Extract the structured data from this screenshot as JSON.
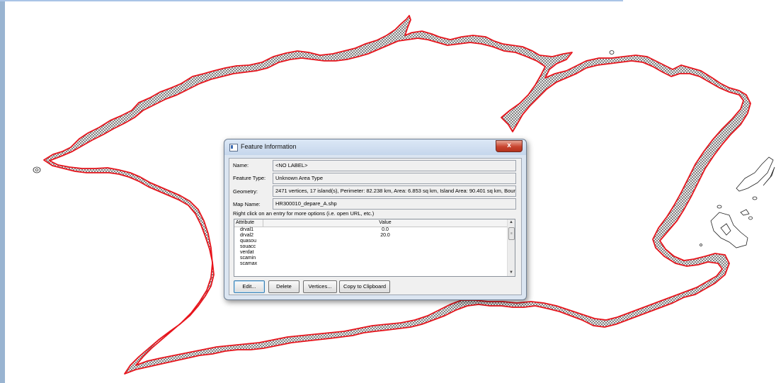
{
  "dialog": {
    "title": "Feature Information",
    "close_glyph": "x",
    "name_label": "Name:",
    "name_value": "<NO LABEL>",
    "feature_type_label": "Feature Type:",
    "feature_type_value": "Unknown Area Type",
    "geometry_label": "Geometry:",
    "geometry_value": "2471 vertices, 17 island(s), Perimeter: 82.238 km, Area: 6.853 sq km, Island Area: 90.401 sq km, Bound",
    "map_name_label": "Map Name:",
    "map_name_value": "HR300010_depare_A.shp",
    "hint": "Right click on an entry for more options (i.e. open URL, etc.)",
    "grid": {
      "col_attribute": "Attribute",
      "col_value": "Value",
      "rows": [
        {
          "attr": "drval1",
          "value": "0.0"
        },
        {
          "attr": "drval2",
          "value": "20.0"
        },
        {
          "attr": "quasou",
          "value": ""
        },
        {
          "attr": "souacc",
          "value": ""
        },
        {
          "attr": "verdat",
          "value": ""
        },
        {
          "attr": "scamin",
          "value": ""
        },
        {
          "attr": "scamax",
          "value": ""
        }
      ],
      "scroll_up": "▲",
      "scroll_down": "▼",
      "thumb_grip": "≡"
    },
    "buttons": {
      "edit": "Edit...",
      "delete": "Delete",
      "vertices": "Vertices...",
      "copy": "Copy to Clipboard"
    }
  },
  "colors": {
    "coastline": "#e8141c",
    "hatch": "#555555",
    "window_frame": "#dbe5f1",
    "close_button": "#c8442f"
  },
  "icons": [
    "window-icon",
    "close-icon",
    "scroll-up-icon",
    "scroll-down-icon"
  ]
}
